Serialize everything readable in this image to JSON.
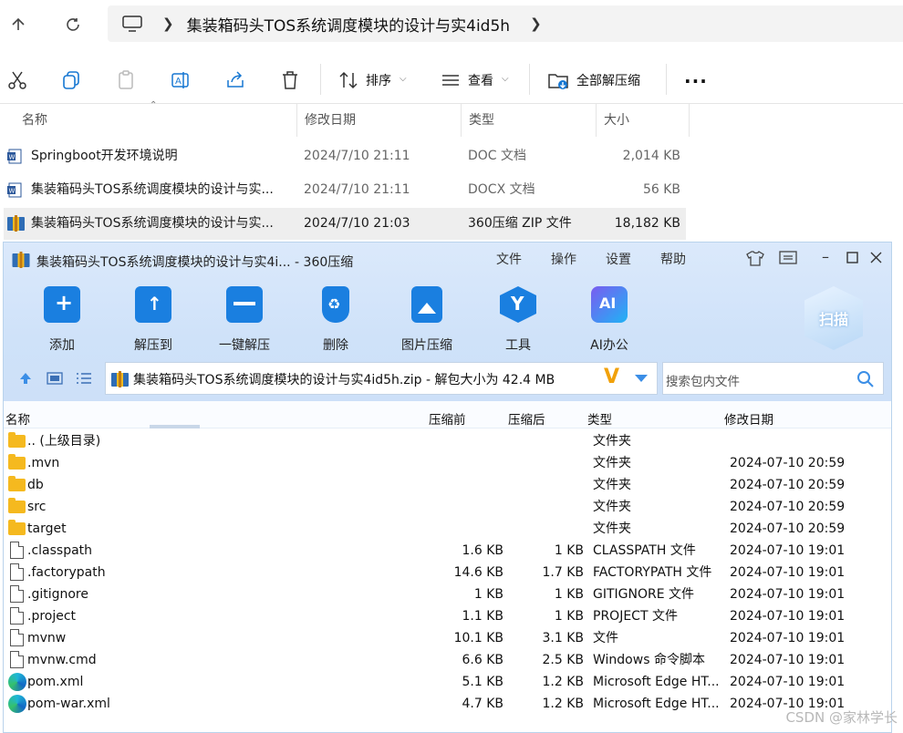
{
  "explorer": {
    "path_segment": "集装箱码头TOS系统调度模块的设计与实4id5h",
    "toolbar": {
      "sort_label": "排序",
      "view_label": "查看",
      "extract_all_label": "全部解压缩",
      "more_label": "..."
    },
    "columns": {
      "name": "名称",
      "date": "修改日期",
      "type": "类型",
      "size": "大小"
    },
    "files": [
      {
        "name": "Springboot开发环境说明",
        "date": "2024/7/10 21:11",
        "type": "DOC 文档",
        "size": "2,014 KB"
      },
      {
        "name": "集装箱码头TOS系统调度模块的设计与实...",
        "date": "2024/7/10 21:11",
        "type": "DOCX 文档",
        "size": "56 KB"
      },
      {
        "name": "集装箱码头TOS系统调度模块的设计与实...",
        "date": "2024/7/10 21:03",
        "type": "360压缩 ZIP 文件",
        "size": "18,182 KB"
      }
    ]
  },
  "zip": {
    "title": "集装箱码头TOS系统调度模块的设计与实4i... - 360压缩",
    "menu": [
      "文件",
      "操作",
      "设置",
      "帮助"
    ],
    "buttons": [
      "添加",
      "解压到",
      "一键解压",
      "删除",
      "图片压缩",
      "工具",
      "AI办公"
    ],
    "scan_label": "扫描",
    "path_text": "集装箱码头TOS系统调度模块的设计与实4id5h.zip - 解包大小为 42.4 MB",
    "search_placeholder": "搜索包内文件",
    "columns": {
      "name": "名称",
      "before": "压缩前",
      "after": "压缩后",
      "type": "类型",
      "date": "修改日期"
    },
    "rows": [
      {
        "icon": "folder",
        "name": ".. (上级目录)",
        "before": "",
        "after": "",
        "type": "文件夹",
        "date": ""
      },
      {
        "icon": "folder",
        "name": ".mvn",
        "before": "",
        "after": "",
        "type": "文件夹",
        "date": "2024-07-10 20:59"
      },
      {
        "icon": "folder",
        "name": "db",
        "before": "",
        "after": "",
        "type": "文件夹",
        "date": "2024-07-10 20:59"
      },
      {
        "icon": "folder",
        "name": "src",
        "before": "",
        "after": "",
        "type": "文件夹",
        "date": "2024-07-10 20:59"
      },
      {
        "icon": "folder",
        "name": "target",
        "before": "",
        "after": "",
        "type": "文件夹",
        "date": "2024-07-10 20:59"
      },
      {
        "icon": "file",
        "name": ".classpath",
        "before": "1.6 KB",
        "after": "1 KB",
        "type": "CLASSPATH 文件",
        "date": "2024-07-10 19:01"
      },
      {
        "icon": "file",
        "name": ".factorypath",
        "before": "14.6 KB",
        "after": "1.7 KB",
        "type": "FACTORYPATH 文件",
        "date": "2024-07-10 19:01"
      },
      {
        "icon": "file",
        "name": ".gitignore",
        "before": "1 KB",
        "after": "1 KB",
        "type": "GITIGNORE 文件",
        "date": "2024-07-10 19:01"
      },
      {
        "icon": "file",
        "name": ".project",
        "before": "1.1 KB",
        "after": "1 KB",
        "type": "PROJECT 文件",
        "date": "2024-07-10 19:01"
      },
      {
        "icon": "file",
        "name": "mvnw",
        "before": "10.1 KB",
        "after": "3.1 KB",
        "type": "文件",
        "date": "2024-07-10 19:01"
      },
      {
        "icon": "cmd",
        "name": "mvnw.cmd",
        "before": "6.6 KB",
        "after": "2.5 KB",
        "type": "Windows 命令脚本",
        "date": "2024-07-10 19:01"
      },
      {
        "icon": "edge",
        "name": "pom.xml",
        "before": "5.1 KB",
        "after": "1.2 KB",
        "type": "Microsoft Edge HT...",
        "date": "2024-07-10 19:01"
      },
      {
        "icon": "edge",
        "name": "pom-war.xml",
        "before": "4.7 KB",
        "after": "1.2 KB",
        "type": "Microsoft Edge HT...",
        "date": "2024-07-10 19:01"
      }
    ]
  },
  "watermark": "CSDN @家林学长",
  "colors": {
    "accent": "#1677d2",
    "zip_bg": "#d4e5fa",
    "folder": "#f5b91f"
  }
}
